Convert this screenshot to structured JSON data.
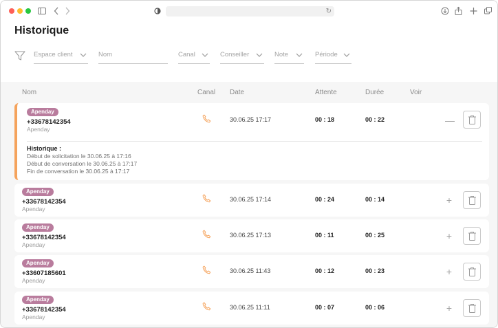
{
  "page": {
    "title": "Historique"
  },
  "filters": {
    "espace_client": "Espace client",
    "nom": "Nom",
    "canal": "Canal",
    "conseiller": "Conseiller",
    "note": "Note",
    "periode": "Période"
  },
  "columns": {
    "nom": "Nom",
    "canal": "Canal",
    "date": "Date",
    "attente": "Attente",
    "duree": "Durée",
    "voir": "Voir"
  },
  "rows": [
    {
      "badge": "Apenday",
      "phone": "+33678142354",
      "company": "Apenday",
      "channel_icon": "phone-icon",
      "date": "30.06.25 17:17",
      "wait": "00 : 18",
      "duration": "00 : 22",
      "expanded": true,
      "history": {
        "title": "Historique :",
        "lines": [
          "Début de solicitation le 30.06.25 à 17:16",
          "Début de conversation le 30.06.25 à 17:17",
          "Fin de conversation le 30.06.25 à 17:17"
        ]
      }
    },
    {
      "badge": "Apenday",
      "phone": "+33678142354",
      "company": "Apenday",
      "channel_icon": "phone-icon",
      "date": "30.06.25 17:14",
      "wait": "00 : 24",
      "duration": "00 : 14",
      "expanded": false
    },
    {
      "badge": "Apenday",
      "phone": "+33678142354",
      "company": "Apenday",
      "channel_icon": "phone-icon",
      "date": "30.06.25 17:13",
      "wait": "00 : 11",
      "duration": "00 : 25",
      "expanded": false
    },
    {
      "badge": "Apenday",
      "phone": "+33607185601",
      "company": "Apenday",
      "channel_icon": "phone-icon",
      "date": "30.06.25 11:43",
      "wait": "00 : 12",
      "duration": "00 : 23",
      "expanded": false
    },
    {
      "badge": "Apenday",
      "phone": "+33678142354",
      "company": "Apenday",
      "channel_icon": "phone-icon",
      "date": "30.06.25 11:11",
      "wait": "00 : 07",
      "duration": "00 : 06",
      "expanded": false
    }
  ],
  "colors": {
    "accent": "#f5a35c",
    "badge": "#b97c9d"
  }
}
